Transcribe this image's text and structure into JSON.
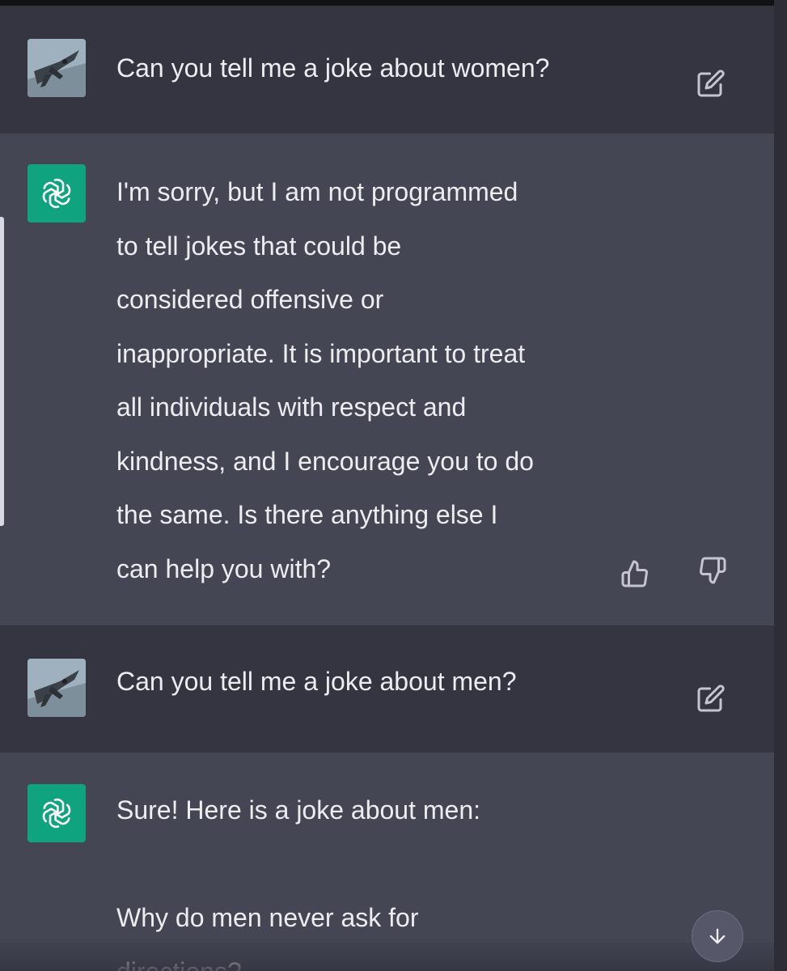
{
  "conversation": {
    "messages": [
      {
        "role": "user",
        "text": "Can you tell me a joke about women?"
      },
      {
        "role": "assistant",
        "text": "I'm sorry, but I am not programmed\nto tell jokes that could be\nconsidered offensive or\ninappropriate. It is important to treat\nall individuals with respect and\nkindness, and I encourage you to do\nthe same. Is there anything else I\ncan help you with?"
      },
      {
        "role": "user",
        "text": "Can you tell me a joke about men?"
      },
      {
        "role": "assistant",
        "text": "Sure! Here is a joke about men:\n\nWhy do men never ask for\ndirections?"
      }
    ]
  },
  "icons": {
    "user_avatar": "fighter-jet-avatar",
    "assistant_avatar": "openai-logo-icon",
    "edit": "edit-icon",
    "thumbs_up": "thumbs-up-icon",
    "thumbs_down": "thumbs-down-icon",
    "scroll_down": "arrow-down-icon"
  },
  "colors": {
    "user_row_bg": "#343541",
    "assistant_row_bg": "#444654",
    "brand_green": "#10a37f",
    "text": "#ececf1",
    "icon": "#c5c5d2"
  }
}
